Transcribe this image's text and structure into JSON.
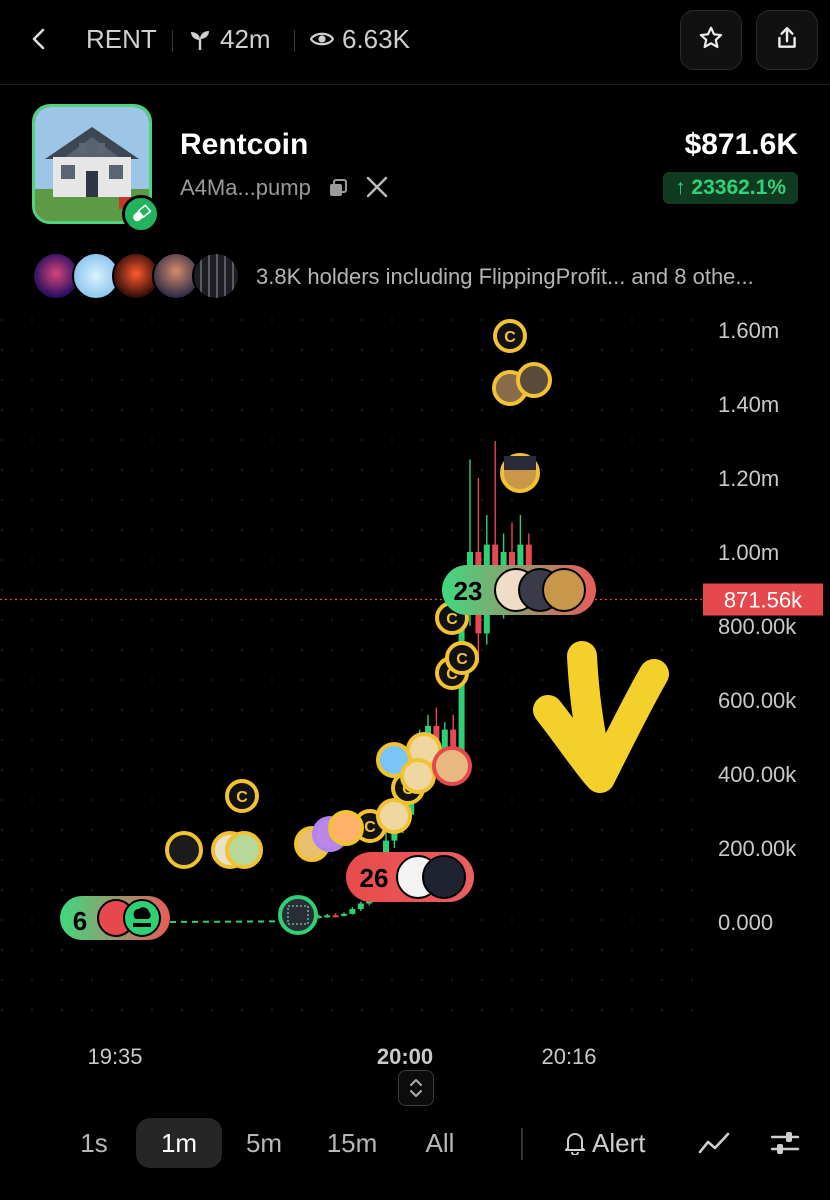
{
  "header": {
    "symbol": "RENT",
    "age": "42m",
    "views": "6.63K",
    "icons": [
      "back-chevron-icon",
      "sprout-icon",
      "eye-icon",
      "star-icon",
      "share-icon"
    ]
  },
  "token": {
    "name": "Rentcoin",
    "address": "A4Ma...pump",
    "market_cap": "$871.6K",
    "change": "↑ 23362.1%",
    "change_color": "#33d17a",
    "border_color": "#4fd37e"
  },
  "holders": {
    "text": "3.8K holders including FlippingProfit... and 8 othe..."
  },
  "chart_data": {
    "type": "candlestick",
    "y_ticks": [
      "1.60m",
      "1.40m",
      "1.20m",
      "1.00m",
      "800.00k",
      "600.00k",
      "400.00k",
      "200.00k",
      "0.000"
    ],
    "x_ticks": [
      "19:35",
      "20:00",
      "20:16"
    ],
    "current_price_label": "871.56k",
    "current_price": 871560,
    "ylim": [
      0,
      1600000
    ],
    "up_color": "#2fcf73",
    "down_color": "#e5484d",
    "candles": [
      {
        "t": "19:43",
        "o": 0,
        "h": 20000,
        "l": 0,
        "c": 15000
      },
      {
        "t": "19:45",
        "o": 15000,
        "h": 18000,
        "l": 8000,
        "c": 12000
      },
      {
        "t": "19:47",
        "o": 12000,
        "h": 20000,
        "l": 10000,
        "c": 16000
      },
      {
        "t": "19:49",
        "o": 16000,
        "h": 22000,
        "l": 12000,
        "c": 18000
      },
      {
        "t": "19:51",
        "o": 18000,
        "h": 24000,
        "l": 14000,
        "c": 17000
      },
      {
        "t": "19:53",
        "o": 17000,
        "h": 26000,
        "l": 15000,
        "c": 22000
      },
      {
        "t": "19:54",
        "o": 22000,
        "h": 40000,
        "l": 20000,
        "c": 35000
      },
      {
        "t": "19:55",
        "o": 35000,
        "h": 55000,
        "l": 30000,
        "c": 50000
      },
      {
        "t": "19:56",
        "o": 50000,
        "h": 90000,
        "l": 45000,
        "c": 80000
      },
      {
        "t": "19:57",
        "o": 80000,
        "h": 150000,
        "l": 75000,
        "c": 130000
      },
      {
        "t": "19:58",
        "o": 130000,
        "h": 250000,
        "l": 120000,
        "c": 220000
      },
      {
        "t": "19:59",
        "o": 220000,
        "h": 300000,
        "l": 200000,
        "c": 260000
      },
      {
        "t": "20:00",
        "o": 260000,
        "h": 310000,
        "l": 240000,
        "c": 290000
      },
      {
        "t": "20:01",
        "o": 290000,
        "h": 480000,
        "l": 280000,
        "c": 450000
      },
      {
        "t": "20:02",
        "o": 450000,
        "h": 520000,
        "l": 400000,
        "c": 480000
      },
      {
        "t": "20:03",
        "o": 480000,
        "h": 560000,
        "l": 420000,
        "c": 530000
      },
      {
        "t": "20:04",
        "o": 530000,
        "h": 580000,
        "l": 430000,
        "c": 460000
      },
      {
        "t": "20:05",
        "o": 460000,
        "h": 540000,
        "l": 420000,
        "c": 520000
      },
      {
        "t": "20:06",
        "o": 520000,
        "h": 560000,
        "l": 430000,
        "c": 450000
      },
      {
        "t": "20:07",
        "o": 450000,
        "h": 900000,
        "l": 440000,
        "c": 870000
      },
      {
        "t": "20:08",
        "o": 870000,
        "h": 1250000,
        "l": 800000,
        "c": 1000000
      },
      {
        "t": "20:09",
        "o": 1000000,
        "h": 1200000,
        "l": 700000,
        "c": 780000
      },
      {
        "t": "20:10",
        "o": 780000,
        "h": 1100000,
        "l": 750000,
        "c": 1020000
      },
      {
        "t": "20:11",
        "o": 1020000,
        "h": 1300000,
        "l": 850000,
        "c": 900000
      },
      {
        "t": "20:12",
        "o": 900000,
        "h": 1050000,
        "l": 820000,
        "c": 1000000
      },
      {
        "t": "20:13",
        "o": 1000000,
        "h": 1080000,
        "l": 900000,
        "c": 960000
      },
      {
        "t": "20:14",
        "o": 960000,
        "h": 1100000,
        "l": 860000,
        "c": 1020000
      },
      {
        "t": "20:15",
        "o": 1020000,
        "h": 1050000,
        "l": 840000,
        "c": 871560
      }
    ],
    "markers": [
      {
        "label": "6",
        "type": "buy-group"
      },
      {
        "label": "26",
        "type": "sell-group"
      },
      {
        "label": "23",
        "type": "buy-group"
      }
    ],
    "coin_markers": [
      "c"
    ]
  },
  "timeframes": {
    "items": [
      "1s",
      "1m",
      "5m",
      "15m",
      "All"
    ],
    "active": "1m",
    "alert_label": "Alert"
  }
}
